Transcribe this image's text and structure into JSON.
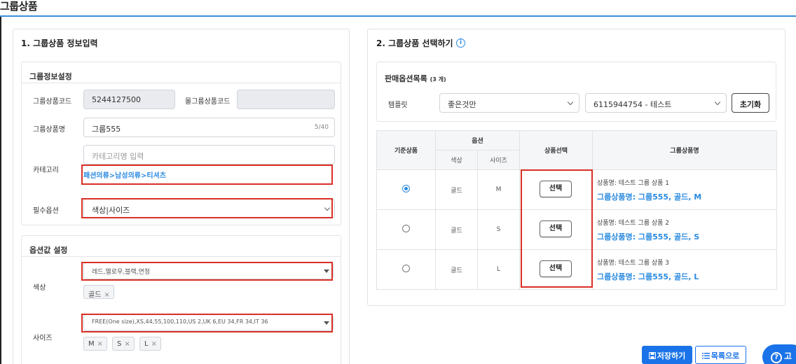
{
  "page": {
    "title": "그룹상품"
  },
  "left": {
    "title": "1. 그룹상품 정보입력",
    "group_info": {
      "title": "그룹정보설정",
      "code_label": "그룹상품코드",
      "code_value": "5244127500",
      "mall_code_label": "몰그룹상품코드",
      "mall_code_value": "",
      "name_label": "그룹상품명",
      "name_value": "그룹555",
      "name_counter": "5/40",
      "category_label": "카테고리",
      "category_placeholder": "카테고리명 입력",
      "category_path": "패션의류>남성의류>티셔츠",
      "required_label": "필수옵션",
      "required_value": "색상|사이즈"
    },
    "option_values": {
      "title": "옵션값 설정",
      "color_label": "색상",
      "color_select": "레드,옐로우,블랙,연청",
      "color_tags": [
        "골드"
      ],
      "size_label": "사이즈",
      "size_select": "FREE(One size),XS,44,55,100,110,US 2,UK 6,EU 34,FR 34,IT 36",
      "size_tags": [
        "M",
        "S",
        "L"
      ],
      "tag_remove": "×"
    }
  },
  "right": {
    "title": "2. 그룹상품 선택하기",
    "info_icon": "i",
    "sale_options": {
      "title": "판매옵션목록",
      "count": "(3 개)",
      "template_label": "템플릿",
      "template_value": "좋은것만",
      "product_value": "6115944754 - 테스트",
      "reset_label": "초기화"
    },
    "table": {
      "headers": {
        "base": "기준상품",
        "option": "옵션",
        "color": "색상",
        "size": "사이즈",
        "select": "상품선택",
        "group_name": "그룹상품명"
      },
      "rows": [
        {
          "selected": true,
          "color": "골드",
          "size": "M",
          "button": "선택",
          "sub": "상품명: 테스트 그룹 상품 1",
          "name": "그룹상품명: 그룹555, 골드, M"
        },
        {
          "selected": false,
          "color": "골드",
          "size": "S",
          "button": "선택",
          "sub": "상품명: 테스트 그룹 상품 2",
          "name": "그룹상품명: 그룹555, 골드, S"
        },
        {
          "selected": false,
          "color": "골드",
          "size": "L",
          "button": "선택",
          "sub": "상품명: 테스트 그룹 상품 3",
          "name": "그룹상품명: 그룹555, 골드, L"
        }
      ]
    }
  },
  "footer": {
    "save_label": "저장하기",
    "list_label": "목록으로",
    "help_label": "고",
    "help_icon": "?"
  },
  "colors": {
    "accent": "#1a73e8",
    "link": "#2b8be0",
    "highlight": "#d93025"
  }
}
